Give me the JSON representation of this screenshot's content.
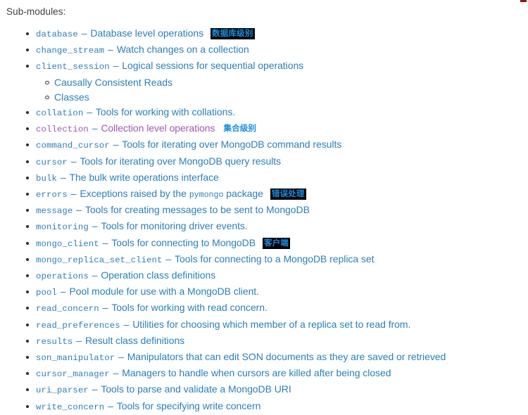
{
  "heading": "Sub-modules:",
  "items": [
    {
      "module": "database",
      "module_visited": false,
      "dash": "–",
      "desc": "Database level operations",
      "desc_visited": false,
      "badge": {
        "text": "数据库级别",
        "style": "dark"
      }
    },
    {
      "module": "change_stream",
      "module_visited": false,
      "dash": "–",
      "desc": "Watch changes on a collection",
      "desc_visited": false,
      "badge": null
    },
    {
      "module": "client_session",
      "module_visited": false,
      "dash": "–",
      "desc": "Logical sessions for sequential operations",
      "desc_visited": false,
      "badge": null,
      "children": [
        {
          "label": "Causally Consistent Reads"
        },
        {
          "label": "Classes"
        }
      ]
    },
    {
      "module": "collation",
      "module_visited": false,
      "dash": "–",
      "desc": "Tools for working with collations.",
      "desc_visited": false,
      "badge": null
    },
    {
      "module": "collection",
      "module_visited": true,
      "dash": "–",
      "desc": "Collection level operations",
      "desc_visited": true,
      "badge": {
        "text": "集合级别",
        "style": "light"
      }
    },
    {
      "module": "command_cursor",
      "module_visited": false,
      "dash": "–",
      "desc": "Tools for iterating over MongoDB command results",
      "desc_visited": false,
      "badge": null
    },
    {
      "module": "cursor",
      "module_visited": false,
      "dash": "–",
      "desc": "Tools for iterating over MongoDB query results",
      "desc_visited": false,
      "badge": null
    },
    {
      "module": "bulk",
      "module_visited": false,
      "dash": "–",
      "desc": "The bulk write operations interface",
      "desc_visited": false,
      "badge": null
    },
    {
      "module": "errors",
      "module_visited": false,
      "dash": "–",
      "desc_before": "Exceptions raised by the",
      "desc_code": "pymongo",
      "desc_after": "package",
      "desc_visited": false,
      "badge": {
        "text": "错误处理",
        "style": "dark"
      }
    },
    {
      "module": "message",
      "module_visited": false,
      "dash": "–",
      "desc": "Tools for creating messages to be sent to MongoDB",
      "desc_visited": false,
      "badge": null
    },
    {
      "module": "monitoring",
      "module_visited": false,
      "dash": "–",
      "desc": "Tools for monitoring driver events.",
      "desc_visited": false,
      "badge": null
    },
    {
      "module": "mongo_client",
      "module_visited": false,
      "dash": "–",
      "desc": "Tools for connecting to MongoDB",
      "desc_visited": false,
      "badge": {
        "text": "客户端",
        "style": "dark"
      }
    },
    {
      "module": "mongo_replica_set_client",
      "module_visited": false,
      "dash": "–",
      "desc": "Tools for connecting to a MongoDB replica set",
      "desc_visited": false,
      "badge": null
    },
    {
      "module": "operations",
      "module_visited": false,
      "dash": "–",
      "desc": "Operation class definitions",
      "desc_visited": false,
      "badge": null
    },
    {
      "module": "pool",
      "module_visited": false,
      "dash": "–",
      "desc": "Pool module for use with a MongoDB client.",
      "desc_visited": false,
      "badge": null
    },
    {
      "module": "read_concern",
      "module_visited": false,
      "dash": "–",
      "desc": "Tools for working with read concern.",
      "desc_visited": false,
      "badge": null
    },
    {
      "module": "read_preferences",
      "module_visited": false,
      "dash": "–",
      "desc": "Utilities for choosing which member of a replica set to read from.",
      "desc_visited": false,
      "badge": null
    },
    {
      "module": "results",
      "module_visited": false,
      "dash": "–",
      "desc": "Result class definitions",
      "desc_visited": false,
      "badge": null
    },
    {
      "module": "son_manipulator",
      "module_visited": false,
      "dash": "–",
      "desc": "Manipulators that can edit SON documents as they are saved or retrieved",
      "desc_visited": false,
      "badge": null
    },
    {
      "module": "cursor_manager",
      "module_visited": false,
      "dash": "–",
      "desc": "Managers to handle when cursors are killed after being closed",
      "desc_visited": false,
      "badge": null
    },
    {
      "module": "uri_parser",
      "module_visited": false,
      "dash": "–",
      "desc": "Tools to parse and validate a MongoDB URI",
      "desc_visited": false,
      "badge": null
    },
    {
      "module": "write_concern",
      "module_visited": false,
      "dash": "–",
      "desc": "Tools for specifying write concern",
      "desc_visited": false,
      "badge": null
    }
  ],
  "colors": {
    "link": "#2980b9",
    "visited_link": "#9b59b6",
    "text": "#404040",
    "badge_text": "#1a8fe0",
    "badge_dark_bg": "#000000",
    "badge_light_bg": "#ffffff",
    "corner_mark": "#8b1a12"
  }
}
